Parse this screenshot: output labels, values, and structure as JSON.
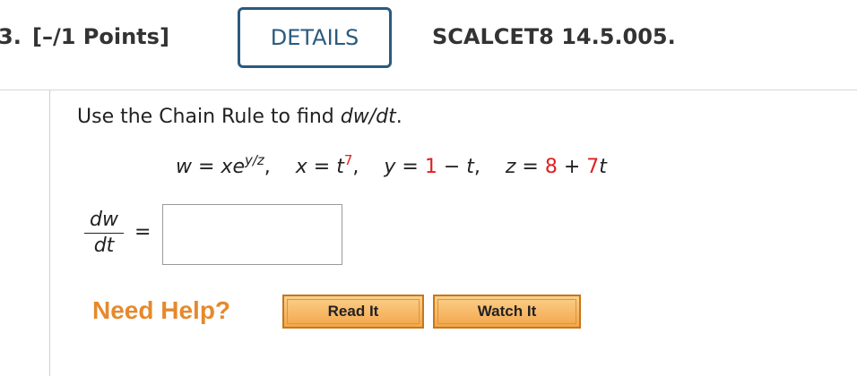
{
  "header": {
    "question_number": "3.",
    "points": "[–/1 Points]",
    "details_label": "DETAILS",
    "problem_code": "SCALCET8 14.5.005."
  },
  "problem": {
    "instruction_prefix": "Use the Chain Rule to find ",
    "instruction_target": "dw/dt",
    "instruction_suffix": ".",
    "eq_w_lhs": "w",
    "eq_w_eq": " = ",
    "eq_w_rhs_base": "xe",
    "eq_w_exp": "y/z",
    "eq_x": "x",
    "eq_x_base": "t",
    "eq_x_exp": "7",
    "eq_y": "y",
    "eq_y_const": "1",
    "eq_y_rest": "t",
    "eq_z": "z",
    "eq_z_const": "8",
    "eq_z_coef": "7",
    "eq_z_var": "t"
  },
  "answer": {
    "frac_num": "dw",
    "frac_den": "dt",
    "equals": "=",
    "value": ""
  },
  "help": {
    "label": "Need Help?",
    "read_label": "Read It",
    "watch_label": "Watch It"
  },
  "colors": {
    "accent_blue": "#2a5a7e",
    "help_orange": "#e6892c",
    "highlight_red": "#e02020"
  }
}
